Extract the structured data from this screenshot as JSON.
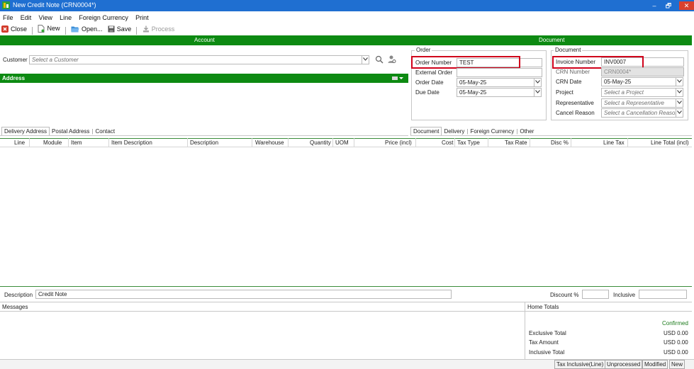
{
  "window": {
    "title": "New Credit Note (CRN0004*)",
    "minimize": "–",
    "restore": "🗗",
    "close": "✕"
  },
  "menu": [
    "File",
    "Edit",
    "View",
    "Line",
    "Foreign Currency",
    "Print"
  ],
  "toolbar": {
    "close": "Close",
    "new": "New",
    "open": "Open...",
    "save": "Save",
    "process": "Process"
  },
  "sections": {
    "account": "Account",
    "document": "Document"
  },
  "customer": {
    "label": "Customer",
    "placeholder": "Select a Customer"
  },
  "address": {
    "title": "Address"
  },
  "address_tabs": [
    "Delivery Address",
    "Postal Address",
    "Contact"
  ],
  "order": {
    "group_title": "Order",
    "order_number_label": "Order Number",
    "order_number_value": "TEST",
    "external_order_label": "External Order",
    "external_order_value": "",
    "order_date_label": "Order Date",
    "order_date_value": "05-May-25",
    "due_date_label": "Due Date",
    "due_date_value": "05-May-25"
  },
  "document": {
    "group_title": "Document",
    "invoice_number_label": "Invoice Number",
    "invoice_number_value": "INV0007",
    "crn_number_label": "CRN Number",
    "crn_number_value": "CRN0004*",
    "crn_date_label": "CRN Date",
    "crn_date_value": "05-May-25",
    "project_label": "Project",
    "project_placeholder": "Select a Project",
    "representative_label": "Representative",
    "representative_placeholder": "Select a Representative",
    "cancel_reason_label": "Cancel Reason",
    "cancel_reason_placeholder": "Select a Cancellation Reason"
  },
  "document_tabs": [
    "Document",
    "Delivery",
    "Foreign Currency",
    "Other"
  ],
  "grid_columns": [
    "Line",
    "Module",
    "Item",
    "Item Description",
    "Description",
    "Warehouse",
    "Quantity",
    "UOM",
    "Price (incl)",
    "Cost",
    "Tax Type",
    "Tax Rate",
    "Disc %",
    "Line Tax",
    "Line Total (incl)"
  ],
  "footer": {
    "description_label": "Description",
    "description_value": "Credit Note",
    "discount_label": "Discount %",
    "inclusive_label": "Inclusive"
  },
  "messages": {
    "title": "Messages"
  },
  "home_totals": {
    "title": "Home Totals",
    "status": "Confirmed",
    "rows": [
      {
        "label": "Exclusive Total",
        "value": "USD 0.00"
      },
      {
        "label": "Tax Amount",
        "value": "USD 0.00"
      },
      {
        "label": "Inclusive Total",
        "value": "USD 0.00"
      }
    ]
  },
  "statusbar": [
    "Tax Inclusive(Line)",
    "Unprocessed",
    "Modified",
    "New"
  ],
  "colors": {
    "titlebar": "#1f6fd1",
    "green": "#0d8a12",
    "highlight": "#d0021b",
    "confirmed": "#1b7a1b"
  }
}
